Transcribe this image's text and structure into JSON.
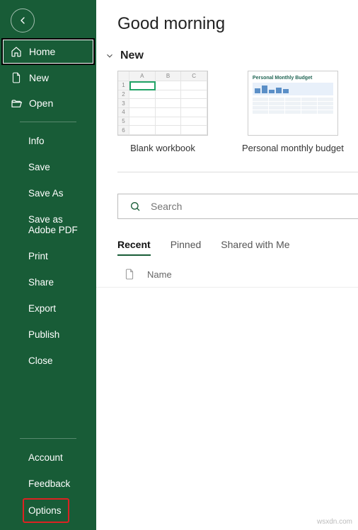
{
  "sidebar": {
    "primary": [
      {
        "label": "Home",
        "icon": "home-icon",
        "selected": true
      },
      {
        "label": "New",
        "icon": "new-icon"
      },
      {
        "label": "Open",
        "icon": "open-icon"
      }
    ],
    "secondary": [
      "Info",
      "Save",
      "Save As",
      "Save as Adobe PDF",
      "Print",
      "Share",
      "Export",
      "Publish",
      "Close"
    ],
    "bottom": [
      "Account",
      "Feedback"
    ],
    "options": "Options"
  },
  "main": {
    "heading": "Good morning",
    "new_section": "New",
    "templates": [
      {
        "label": "Blank workbook",
        "kind": "blank"
      },
      {
        "label": "Personal monthly budget",
        "kind": "budget",
        "thumb_title": "Personal Monthly Budget"
      }
    ],
    "search": {
      "placeholder": "Search"
    },
    "tabs": [
      "Recent",
      "Pinned",
      "Shared with Me"
    ],
    "active_tab": 0,
    "list_header": "Name",
    "blank_cols": [
      "A",
      "B",
      "C"
    ],
    "blank_rows": [
      "1",
      "2",
      "3",
      "4",
      "5",
      "6"
    ]
  },
  "watermark": "wsxdn.com"
}
